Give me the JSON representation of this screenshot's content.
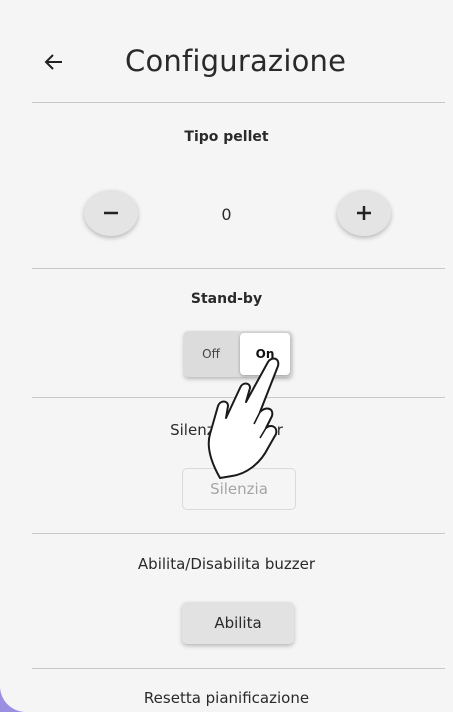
{
  "header": {
    "title": "Configurazione",
    "back_icon": "arrow-left-icon"
  },
  "pellet": {
    "title": "Tipo pellet",
    "value": "0",
    "decrement_icon": "minus-icon",
    "increment_icon": "plus-icon"
  },
  "standby": {
    "title": "Stand-by",
    "off_label": "Off",
    "on_label": "On",
    "selected": "On"
  },
  "silence": {
    "title": "Silenzia buzzer",
    "button_label": "Silenzia",
    "enabled": false
  },
  "buzzer": {
    "title": "Abilita/Disabilita buzzer",
    "button_label": "Abilita"
  },
  "reset": {
    "title": "Resetta pianificazione"
  },
  "overlay": {
    "icon": "tap-hand-icon"
  },
  "colors": {
    "background": "#f5f5f5",
    "frame_accent": "#9a8fe0",
    "divider": "#c9c9c9"
  }
}
